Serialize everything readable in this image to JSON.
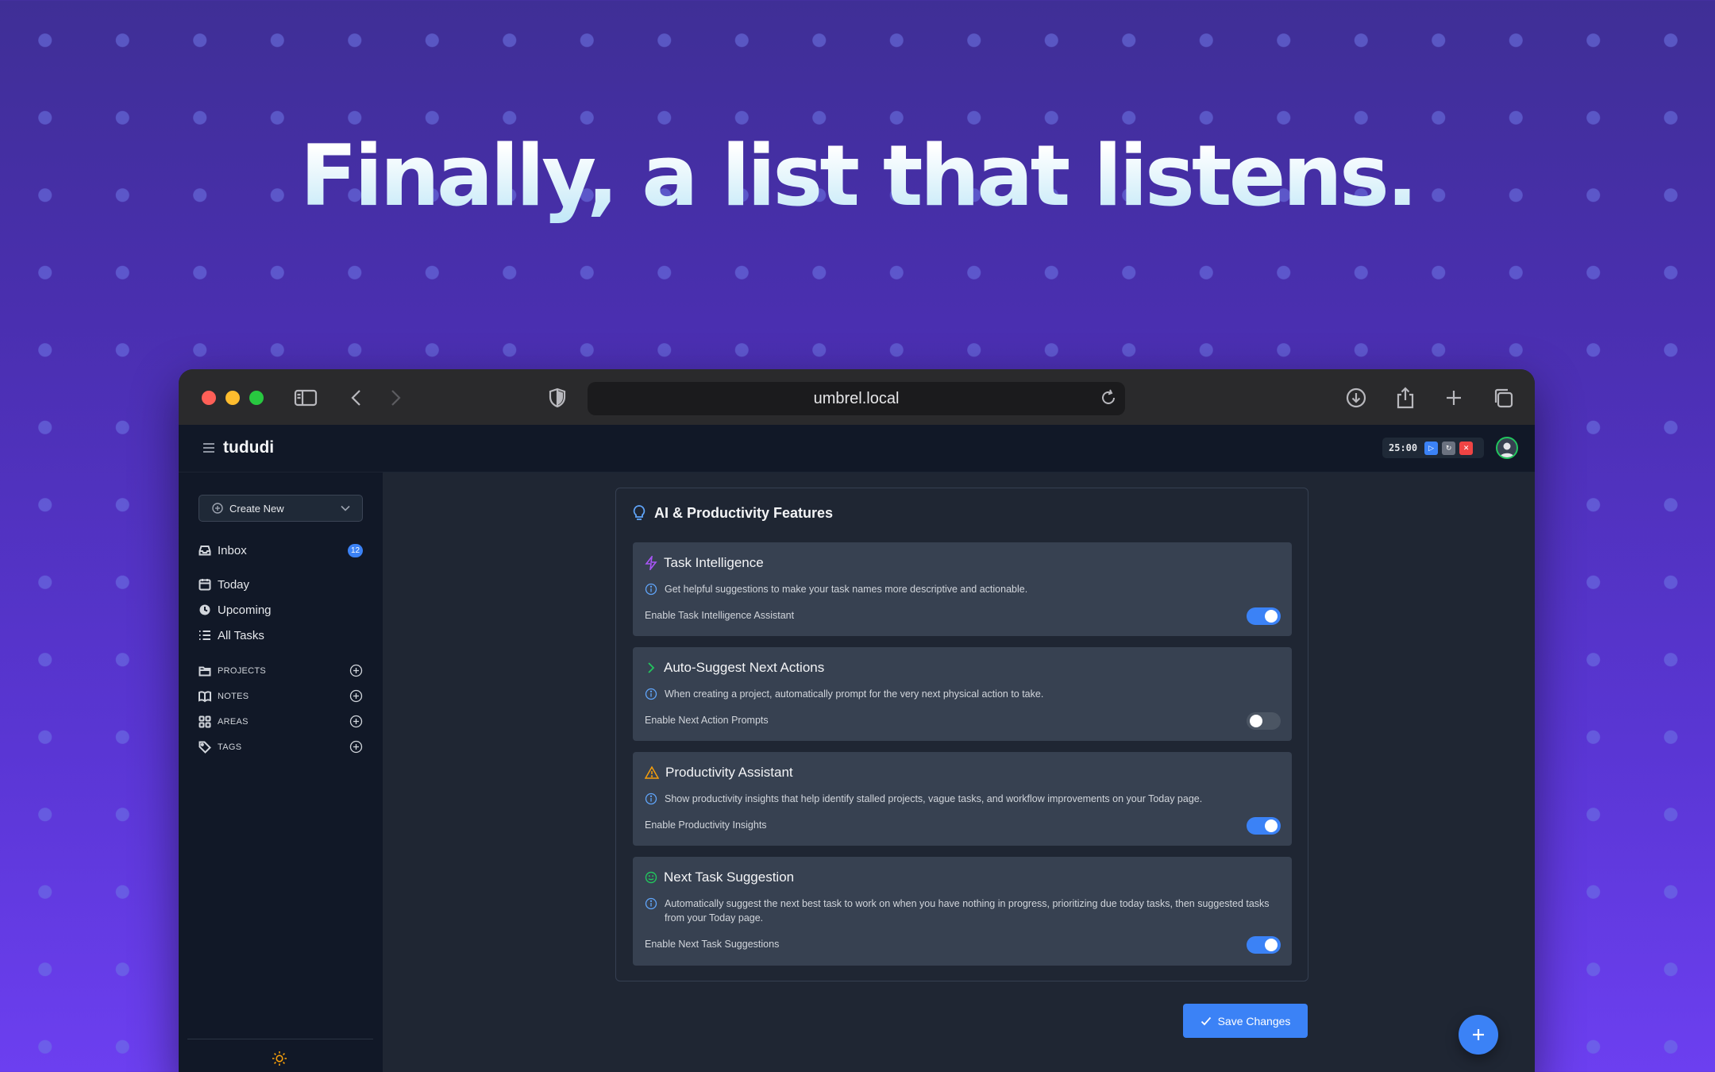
{
  "hero": {
    "headline": "Finally, a list that listens."
  },
  "browser": {
    "url": "umbrel.local",
    "icons": [
      "sidebar-toggle-icon",
      "back-icon",
      "forward-icon",
      "shield-icon",
      "reload-icon",
      "download-icon",
      "share-icon",
      "new-tab-icon",
      "tabs-overview-icon"
    ]
  },
  "app": {
    "brand": "tududi",
    "pomodoro": {
      "time": "25:00"
    }
  },
  "sidebar": {
    "create_new": "Create New",
    "inbox": {
      "label": "Inbox",
      "count": "12"
    },
    "nav": [
      "Today",
      "Upcoming",
      "All Tasks"
    ],
    "sections": [
      "PROJECTS",
      "NOTES",
      "AREAS",
      "TAGS"
    ]
  },
  "settings": {
    "panel_title": "AI & Productivity Features",
    "cards": [
      {
        "title": "Task Intelligence",
        "icon": "lightning-icon",
        "description": "Get helpful suggestions to make your task names more descriptive and actionable.",
        "toggle_label": "Enable Task Intelligence Assistant",
        "enabled": true
      },
      {
        "title": "Auto-Suggest Next Actions",
        "icon": "chevron-right-icon",
        "description": "When creating a project, automatically prompt for the very next physical action to take.",
        "toggle_label": "Enable Next Action Prompts",
        "enabled": false
      },
      {
        "title": "Productivity Assistant",
        "icon": "warning-icon",
        "description": "Show productivity insights that help identify stalled projects, vague tasks, and workflow improvements on your Today page.",
        "toggle_label": "Enable Productivity Insights",
        "enabled": true
      },
      {
        "title": "Next Task Suggestion",
        "icon": "smile-icon",
        "description": "Automatically suggest the next best task to work on when you have nothing in progress, prioritizing due today tasks, then suggested tasks from your Today page.",
        "toggle_label": "Enable Next Task Suggestions",
        "enabled": true
      }
    ],
    "save_label": "Save Changes"
  },
  "colors": {
    "accent": "#3b82f6",
    "sidebar_bg": "#111827",
    "card_bg": "#374151",
    "main_bg": "#1f2633"
  }
}
